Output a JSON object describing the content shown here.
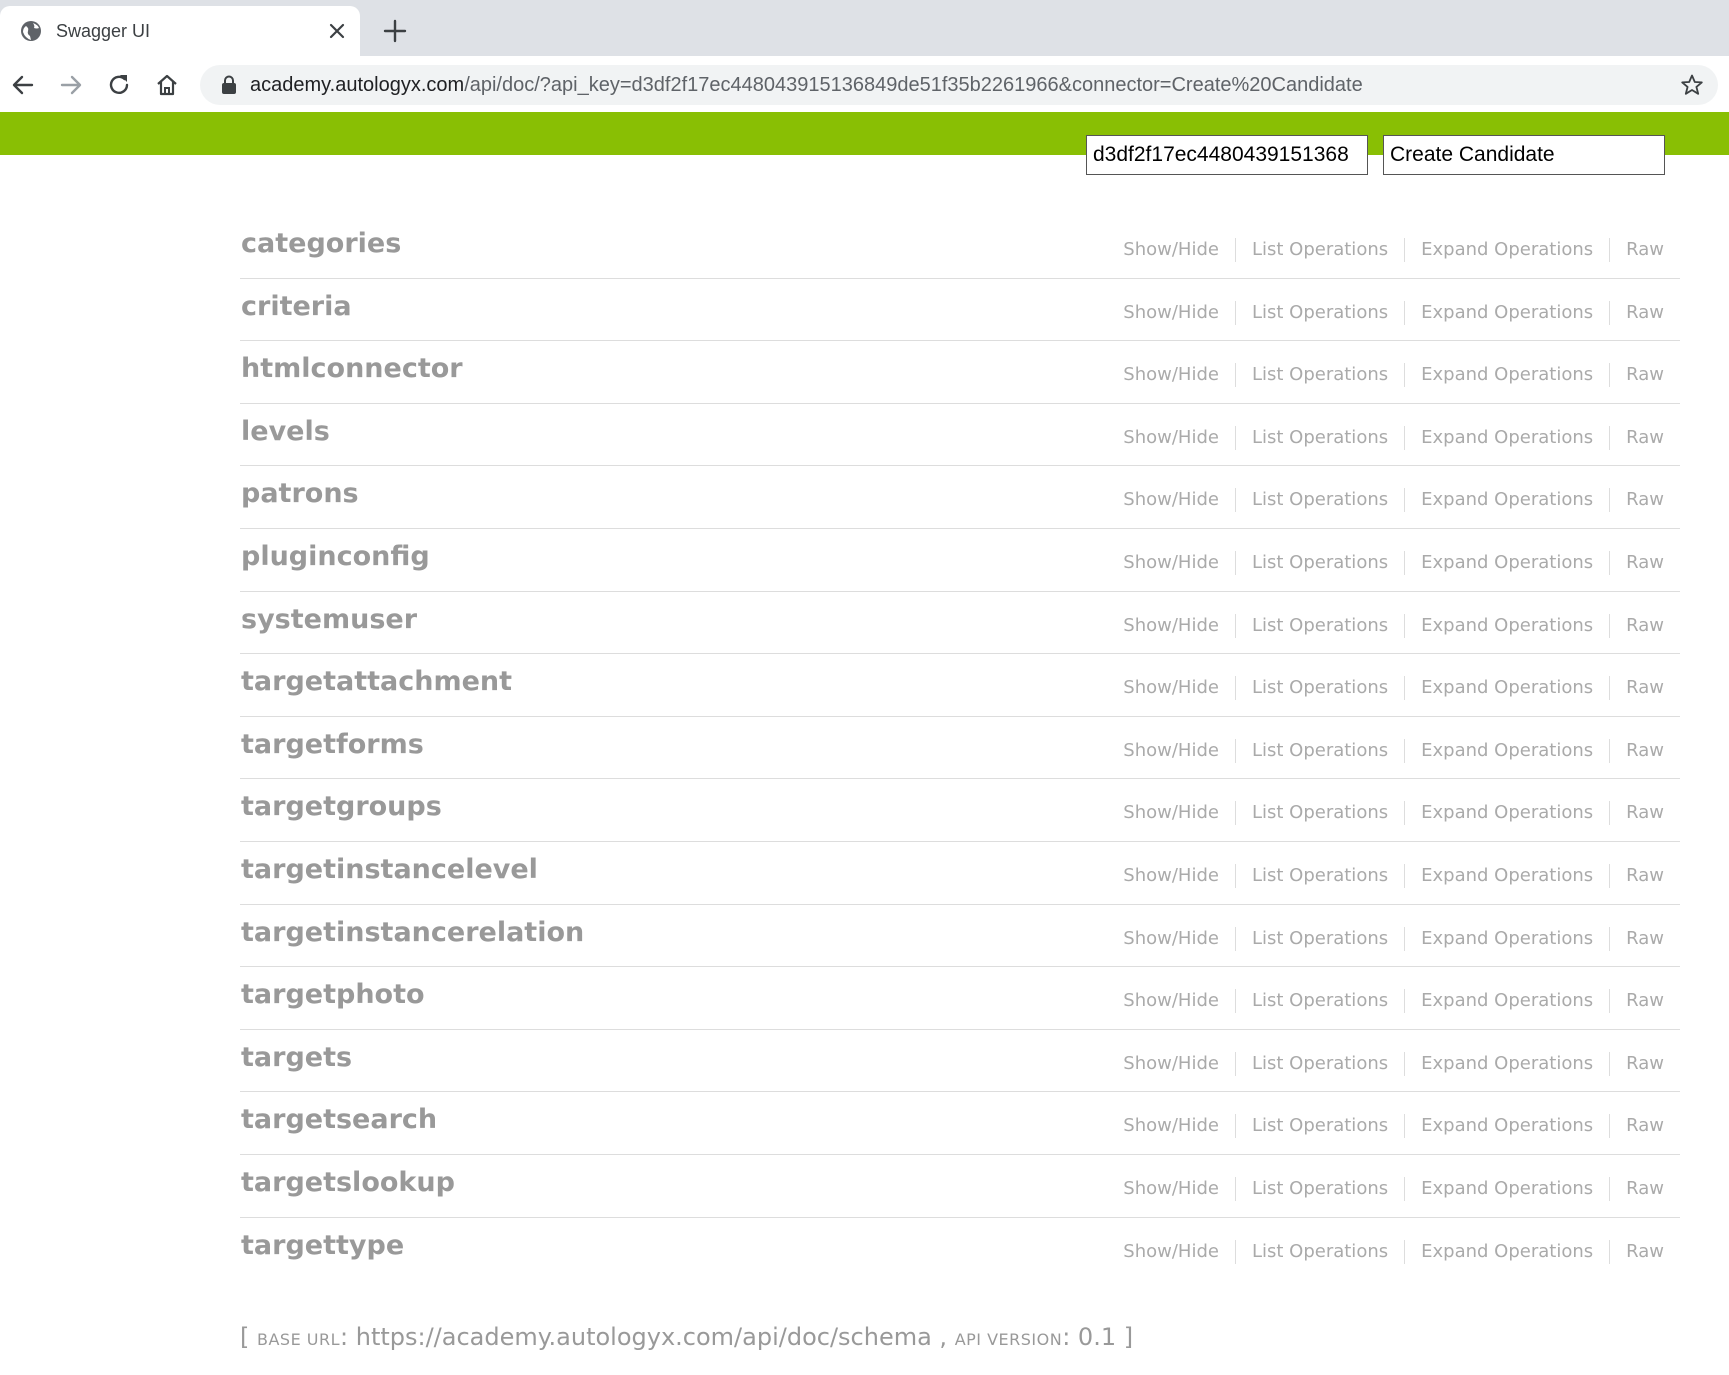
{
  "browser": {
    "tab_title": "Swagger UI",
    "url_host": "academy.autologyx.com",
    "url_path": "/api/doc/?api_key=d3df2f17ec448043915136849de51f35b2261966&connector=Create%20Candidate"
  },
  "header": {
    "api_key_value": "d3df2f17ec4480439151368",
    "connector_value": "Create Candidate",
    "accent_color": "#89bf04"
  },
  "operations_labels": {
    "show_hide": "Show/Hide",
    "list_operations": "List Operations",
    "expand_operations": "Expand Operations",
    "raw": "Raw"
  },
  "resources": [
    {
      "name": "categories"
    },
    {
      "name": "criteria"
    },
    {
      "name": "htmlconnector"
    },
    {
      "name": "levels"
    },
    {
      "name": "patrons"
    },
    {
      "name": "pluginconfig"
    },
    {
      "name": "systemuser"
    },
    {
      "name": "targetattachment"
    },
    {
      "name": "targetforms"
    },
    {
      "name": "targetgroups"
    },
    {
      "name": "targetinstancelevel"
    },
    {
      "name": "targetinstancerelation"
    },
    {
      "name": "targetphoto"
    },
    {
      "name": "targets"
    },
    {
      "name": "targetsearch"
    },
    {
      "name": "targetslookup"
    },
    {
      "name": "targettype"
    }
  ],
  "footer": {
    "open_bracket": "[ ",
    "base_url_label": "BASE URL",
    "base_url": "https://academy.autologyx.com/api/doc/schema",
    "separator": " , ",
    "api_version_label": "API VERSION",
    "api_version": "0.1",
    "close_bracket": " ]"
  }
}
